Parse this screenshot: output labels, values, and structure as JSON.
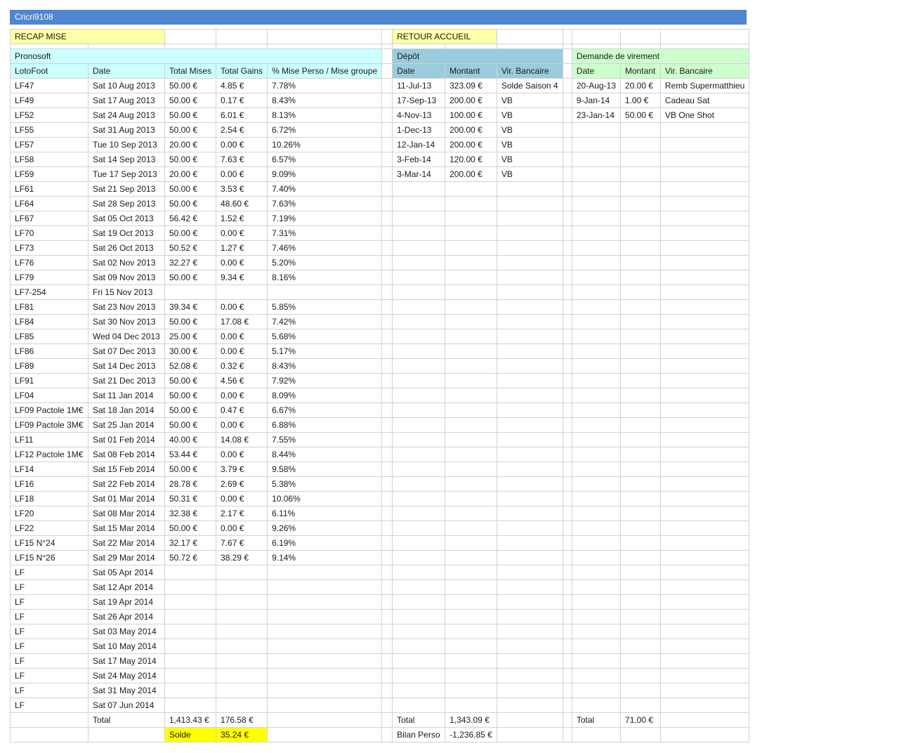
{
  "sheet_title": "Cricri9108",
  "nav": {
    "recap_label": "RECAP MISE",
    "home_label": "RETOUR ACCUEIL"
  },
  "colors": {
    "title_bar": "#4f86cf",
    "yellow": "#ffffa6",
    "highlight": "#ffff00",
    "cyan": "#ccffff",
    "blue": "#99ccdd",
    "green": "#ccffcc"
  },
  "pronosoft": {
    "title": "Pronosoft",
    "headers": [
      "LotoFoot",
      "Date",
      "Total Mises",
      "Total Gains",
      "% Mise Perso / Mise groupe"
    ],
    "rows": [
      [
        "LF47",
        "Sat 10 Aug 2013",
        "50.00 €",
        "4.85 €",
        "7.78%"
      ],
      [
        "LF49",
        "Sat 17 Aug 2013",
        "50.00 €",
        "0.17 €",
        "8.43%"
      ],
      [
        "LF52",
        "Sat 24 Aug 2013",
        "50.00 €",
        "6.01 €",
        "8.13%"
      ],
      [
        "LF55",
        "Sat 31 Aug 2013",
        "50.00 €",
        "2.54 €",
        "6.72%"
      ],
      [
        "LF57",
        "Tue 10 Sep 2013",
        "20.00 €",
        "0.00 €",
        "10.26%"
      ],
      [
        "LF58",
        "Sat 14 Sep 2013",
        "50.00 €",
        "7.63 €",
        "6.57%"
      ],
      [
        "LF59",
        "Tue 17 Sep 2013",
        "20.00 €",
        "0.00 €",
        "9.09%"
      ],
      [
        "LF61",
        "Sat 21 Sep 2013",
        "50.00 €",
        "3.53 €",
        "7.40%"
      ],
      [
        "LF64",
        "Sat 28 Sep 2013",
        "50.00 €",
        "48.60 €",
        "7.63%"
      ],
      [
        "LF67",
        "Sat 05 Oct 2013",
        "56.42 €",
        "1.52 €",
        "7.19%"
      ],
      [
        "LF70",
        "Sat 19 Oct 2013",
        "50.00 €",
        "0.00 €",
        "7.31%"
      ],
      [
        "LF73",
        "Sat 26 Oct 2013",
        "50.52 €",
        "1.27 €",
        "7.46%"
      ],
      [
        "LF76",
        "Sat 02 Nov 2013",
        "32.27 €",
        "0.00 €",
        "5.20%"
      ],
      [
        "LF79",
        "Sat 09 Nov 2013",
        "50.00 €",
        "9.34 €",
        "8.16%"
      ],
      [
        "LF7-254",
        "Fri 15 Nov 2013",
        "",
        "",
        ""
      ],
      [
        "LF81",
        "Sat 23 Nov 2013",
        "39.34 €",
        "0.00 €",
        "5.85%"
      ],
      [
        "LF84",
        "Sat 30 Nov 2013",
        "50.00 €",
        "17.08 €",
        "7.42%"
      ],
      [
        "LF85",
        "Wed 04 Dec 2013",
        "25.00 €",
        "0.00 €",
        "5.68%"
      ],
      [
        "LF86",
        "Sat 07 Dec 2013",
        "30.00 €",
        "0.00 €",
        "5.17%"
      ],
      [
        "LF89",
        "Sat 14 Dec 2013",
        "52.08 €",
        "0.32 €",
        "8.43%"
      ],
      [
        "LF91",
        "Sat 21 Dec 2013",
        "50.00 €",
        "4.56 €",
        "7.92%"
      ],
      [
        "LF04",
        "Sat 11 Jan 2014",
        "50.00 €",
        "0.00 €",
        "8.09%"
      ],
      [
        "LF09 Pactole 1M€",
        "Sat 18 Jan 2014",
        "50.00 €",
        "0.47 €",
        "6.67%"
      ],
      [
        "LF09 Pactole 3M€",
        "Sat 25 Jan 2014",
        "50.00 €",
        "0.00 €",
        "6.88%"
      ],
      [
        "LF11",
        "Sat 01 Feb 2014",
        "40.00 €",
        "14.08 €",
        "7.55%"
      ],
      [
        "LF12 Pactole 1M€",
        "Sat 08 Feb 2014",
        "53.44 €",
        "0.00 €",
        "8.44%"
      ],
      [
        "LF14",
        "Sat 15 Feb 2014",
        "50.00 €",
        "3.79 €",
        "9.58%"
      ],
      [
        "LF16",
        "Sat 22 Feb 2014",
        "28.78 €",
        "2.69 €",
        "5.38%"
      ],
      [
        "LF18",
        "Sat 01 Mar 2014",
        "50.31 €",
        "0.00 €",
        "10.06%"
      ],
      [
        "LF20",
        "Sat 08 Mar 2014",
        "32.38 €",
        "2.17 €",
        "6.11%"
      ],
      [
        "LF22",
        "Sat 15 Mar 2014",
        "50.00 €",
        "0.00 €",
        "9.26%"
      ],
      [
        "LF15 N°24",
        "Sat 22 Mar 2014",
        "32.17 €",
        "7.67 €",
        "6.19%"
      ],
      [
        "LF15 N°26",
        "Sat 29 Mar 2014",
        "50.72 €",
        "38.29 €",
        "9.14%"
      ],
      [
        "LF",
        "Sat 05 Apr 2014",
        "",
        "",
        ""
      ],
      [
        "LF",
        "Sat 12 Apr 2014",
        "",
        "",
        ""
      ],
      [
        "LF",
        "Sat 19 Apr 2014",
        "",
        "",
        ""
      ],
      [
        "LF",
        "Sat 26 Apr 2014",
        "",
        "",
        ""
      ],
      [
        "LF",
        "Sat 03 May 2014",
        "",
        "",
        ""
      ],
      [
        "LF",
        "Sat 10 May 2014",
        "",
        "",
        ""
      ],
      [
        "LF",
        "Sat 17 May 2014",
        "",
        "",
        ""
      ],
      [
        "LF",
        "Sat 24 May 2014",
        "",
        "",
        ""
      ],
      [
        "LF",
        "Sat 31 May 2014",
        "",
        "",
        ""
      ],
      [
        "LF",
        "Sat 07 Jun 2014",
        "",
        "",
        ""
      ]
    ],
    "total_label": "Total",
    "total_mises": "1,413.43 €",
    "total_gains": "176.58 €",
    "solde_label": "Solde",
    "solde_value": "35.24 €"
  },
  "depot": {
    "title": "Dépôt",
    "headers": [
      "Date",
      "Montant",
      "Vir. Bancaire"
    ],
    "rows": [
      [
        "11-Jul-13",
        "323.09 €",
        "Solde Saison 4"
      ],
      [
        "17-Sep-13",
        "200.00 €",
        "VB"
      ],
      [
        "4-Nov-13",
        "100.00 €",
        "VB"
      ],
      [
        "1-Dec-13",
        "200.00 €",
        "VB"
      ],
      [
        "12-Jan-14",
        "200.00 €",
        "VB"
      ],
      [
        "3-Feb-14",
        "120.00 €",
        "VB"
      ],
      [
        "3-Mar-14",
        "200.00 €",
        "VB"
      ]
    ],
    "total_label": "Total",
    "total_value": "1,343.09 €",
    "bilan_label": "Bilan Perso",
    "bilan_value": "-1,236.85 €"
  },
  "virement": {
    "title": "Demande de virement",
    "headers": [
      "Date",
      "Montant",
      "Vir. Bancaire"
    ],
    "rows": [
      [
        "20-Aug-13",
        "20.00 €",
        "Remb Supermatthieu"
      ],
      [
        "9-Jan-14",
        "1.00 €",
        "Cadeau Sat"
      ],
      [
        "23-Jan-14",
        "50.00 €",
        "VB One Shot"
      ]
    ],
    "total_label": "Total",
    "total_value": "71.00 €"
  }
}
